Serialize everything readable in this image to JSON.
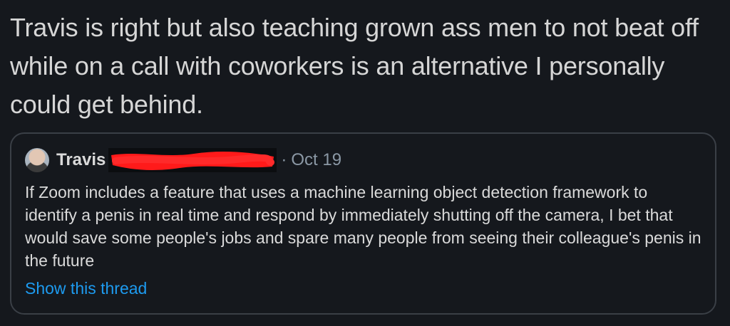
{
  "tweet": {
    "text": "Travis is right but also teaching grown ass men to not beat off while on a call with coworkers is an alternative I personally could get behind."
  },
  "quote": {
    "author_name": "Travis",
    "date_separator": "·",
    "date": "Oct 19",
    "body": "If Zoom includes a feature that uses a machine learning object detection framework to identify a penis in real time and respond by immediately shutting off the camera, I bet that would save some people's jobs and spare many people from seeing their colleague's penis in the future",
    "show_thread_label": "Show this thread",
    "avatar_icon": "user-avatar",
    "redaction_color": "#ff1a1a"
  },
  "colors": {
    "background": "#15181d",
    "link": "#1d9bf0",
    "muted": "#8b98a5",
    "border": "#3a3f46"
  }
}
